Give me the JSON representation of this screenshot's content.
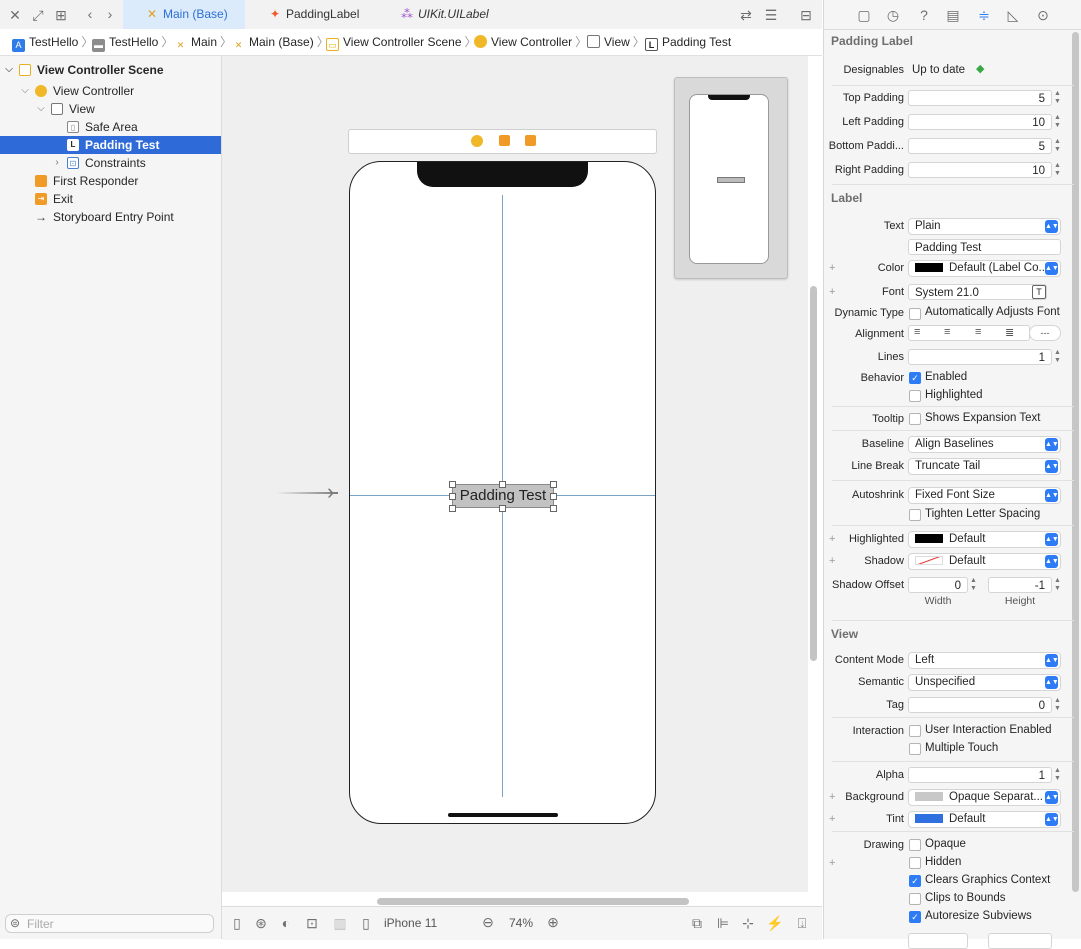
{
  "tabs": [
    {
      "label": "Main (Base)",
      "icon": "storyboard-icon",
      "active": true
    },
    {
      "label": "PaddingLabel",
      "icon": "swift-file-icon",
      "active": false
    },
    {
      "label": "UIKit.UILabel",
      "icon": "framework-icon",
      "active": false
    }
  ],
  "breadcrumbs": [
    "TestHello",
    "TestHello",
    "Main",
    "Main (Base)",
    "View Controller Scene",
    "View Controller",
    "View",
    "Padding Test"
  ],
  "navigator": {
    "items": [
      {
        "label": "View Controller Scene",
        "bold": true
      },
      {
        "label": "View Controller"
      },
      {
        "label": "View"
      },
      {
        "label": "Safe Area"
      },
      {
        "label": "Padding Test",
        "selected": true
      },
      {
        "label": "Constraints"
      },
      {
        "label": "First Responder"
      },
      {
        "label": "Exit"
      },
      {
        "label": "Storyboard Entry Point"
      }
    ],
    "filter_placeholder": "Filter"
  },
  "canvas": {
    "label_text": "Padding Test",
    "device": "iPhone 11",
    "zoom": "74%"
  },
  "inspector": {
    "padding_header": "Padding Label",
    "designables_label": "Designables",
    "designables_value": "Up to date",
    "top_padding_label": "Top Padding",
    "top_padding": "5",
    "left_padding_label": "Left Padding",
    "left_padding": "10",
    "bottom_padding_label": "Bottom Paddi...",
    "bottom_padding": "5",
    "right_padding_label": "Right Padding",
    "right_padding": "10",
    "label_header": "Label",
    "text_label": "Text",
    "text_type": "Plain",
    "text_value": "Padding Test",
    "color_label": "Color",
    "color_value": "Default (Label Co...",
    "font_label": "Font",
    "font_value": "System 21.0",
    "dynamic_type_label": "Dynamic Type",
    "dynamic_type_value": "Automatically Adjusts Font",
    "alignment_label": "Alignment",
    "lines_label": "Lines",
    "lines_value": "1",
    "behavior_label": "Behavior",
    "enabled": "Enabled",
    "highlighted_opt": "Highlighted",
    "tooltip_label": "Tooltip",
    "tooltip_value": "Shows Expansion Text",
    "baseline_label": "Baseline",
    "baseline_value": "Align Baselines",
    "line_break_label": "Line Break",
    "line_break_value": "Truncate Tail",
    "autoshrink_label": "Autoshrink",
    "autoshrink_value": "Fixed Font Size",
    "tighten": "Tighten Letter Spacing",
    "highlighted_label": "Highlighted",
    "highlighted_value": "Default",
    "shadow_label": "Shadow",
    "shadow_value": "Default",
    "shadow_offset_label": "Shadow Offset",
    "shadow_w": "0",
    "shadow_h": "-1",
    "width_label": "Width",
    "height_label": "Height",
    "view_header": "View",
    "content_mode_label": "Content Mode",
    "content_mode_value": "Left",
    "semantic_label": "Semantic",
    "semantic_value": "Unspecified",
    "tag_label": "Tag",
    "tag_value": "0",
    "interaction_label": "Interaction",
    "user_interaction": "User Interaction Enabled",
    "multiple_touch": "Multiple Touch",
    "alpha_label": "Alpha",
    "alpha_value": "1",
    "background_label": "Background",
    "background_value": "Opaque Separat...",
    "tint_label": "Tint",
    "tint_value": "Default",
    "drawing_label": "Drawing",
    "opaque": "Opaque",
    "hidden": "Hidden",
    "clears": "Clears Graphics Context",
    "clips": "Clips to Bounds",
    "autoresize": "Autoresize Subviews"
  },
  "colors": {
    "accent": "#2d7cf6",
    "selection": "#2f6bd8",
    "tint_swatch": "#2f6fe0",
    "background_swatch": "#c8c8c8"
  }
}
